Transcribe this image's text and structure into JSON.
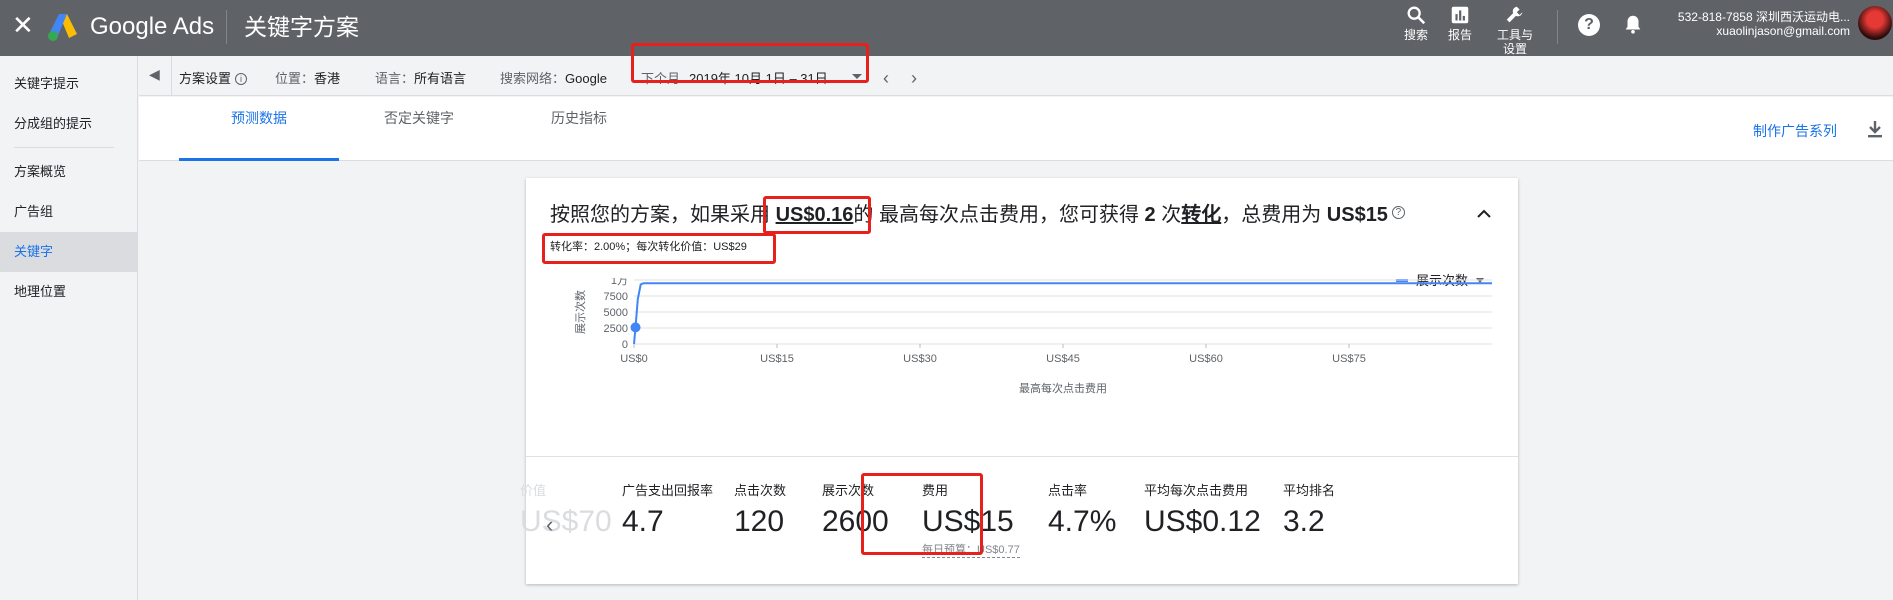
{
  "app": {
    "close_glyph": "✕",
    "brand": "Google Ads",
    "title": "关键字方案"
  },
  "topbar": {
    "search_label": "搜索",
    "reports_label": "报告",
    "tools_label": "工具与设置",
    "help_glyph": "?",
    "account_line1": "532-818-7858 深圳西沃运动电...",
    "account_line2": "xuaolinjason@gmail.com",
    "icons": [
      "search-icon",
      "bar-chart-icon",
      "wrench-icon",
      "help-icon",
      "bell-icon",
      "avatar"
    ]
  },
  "sidebar": {
    "items": [
      {
        "label": "关键字提示",
        "active": false
      },
      {
        "label": "分成组的提示",
        "active": false
      },
      {
        "label": "方案概览",
        "active": false
      },
      {
        "label": "广告组",
        "active": false
      },
      {
        "label": "关键字",
        "active": true
      },
      {
        "label": "地理位置",
        "active": false
      }
    ]
  },
  "settings": {
    "plan_settings": "方案设置",
    "location_label": "位置：",
    "location_value": "香港",
    "language_label": "语言：",
    "language_value": "所有语言",
    "network_label": "搜索网络：",
    "network_value": "Google",
    "range_label": "下个月",
    "range_value": "2019年 10月 1日 – 31日"
  },
  "tabs": [
    {
      "label": "预测数据",
      "active": true
    },
    {
      "label": "否定关键字",
      "active": false
    },
    {
      "label": "历史指标",
      "active": false
    }
  ],
  "actions": {
    "make_campaign": "制作广告系列"
  },
  "summary": {
    "prefix": "按照您的方案，如果采用 ",
    "cpc": "US$0.16",
    "mid": "的 最高每次点击费用，您可获得 ",
    "conversions": "2",
    "unit": " 次",
    "conv_word": "转化",
    "cost_prefix": "，总费用为 ",
    "cost": "US$15",
    "sub": "转化率：2.00%；每次转化价值：US$29"
  },
  "legend": {
    "label": "展示次数",
    "color": "#4285f4"
  },
  "chart_data": {
    "type": "line",
    "title": "",
    "xlabel": "最高每次点击费用",
    "ylabel": "展示次数",
    "x_ticks": [
      "US$0",
      "US$15",
      "US$30",
      "US$45",
      "US$60",
      "US$75"
    ],
    "y_ticks": [
      "0",
      "2500",
      "5000",
      "7500",
      "1万"
    ],
    "xlim": [
      0,
      90
    ],
    "ylim": [
      0,
      10000
    ],
    "series": [
      {
        "name": "展示次数",
        "x": [
          0,
          0.16,
          0.4,
          0.7,
          1.0,
          90
        ],
        "y": [
          0,
          2600,
          7000,
          9300,
          9500,
          9500
        ]
      }
    ],
    "marker": {
      "x": 0.16,
      "y": 2600
    }
  },
  "metrics": [
    {
      "label": "价值",
      "value": "US$70",
      "faded": true
    },
    {
      "label": "广告支出回报率",
      "value": "4.7"
    },
    {
      "label": "点击次数",
      "value": "120"
    },
    {
      "label": "展示次数",
      "value": "2600"
    },
    {
      "label": "费用",
      "value": "US$15",
      "note": "每日预算：US$0.77"
    },
    {
      "label": "点击率",
      "value": "4.7%"
    },
    {
      "label": "平均每次点击费用",
      "value": "US$0.12"
    },
    {
      "label": "平均排名",
      "value": "3.2"
    }
  ]
}
